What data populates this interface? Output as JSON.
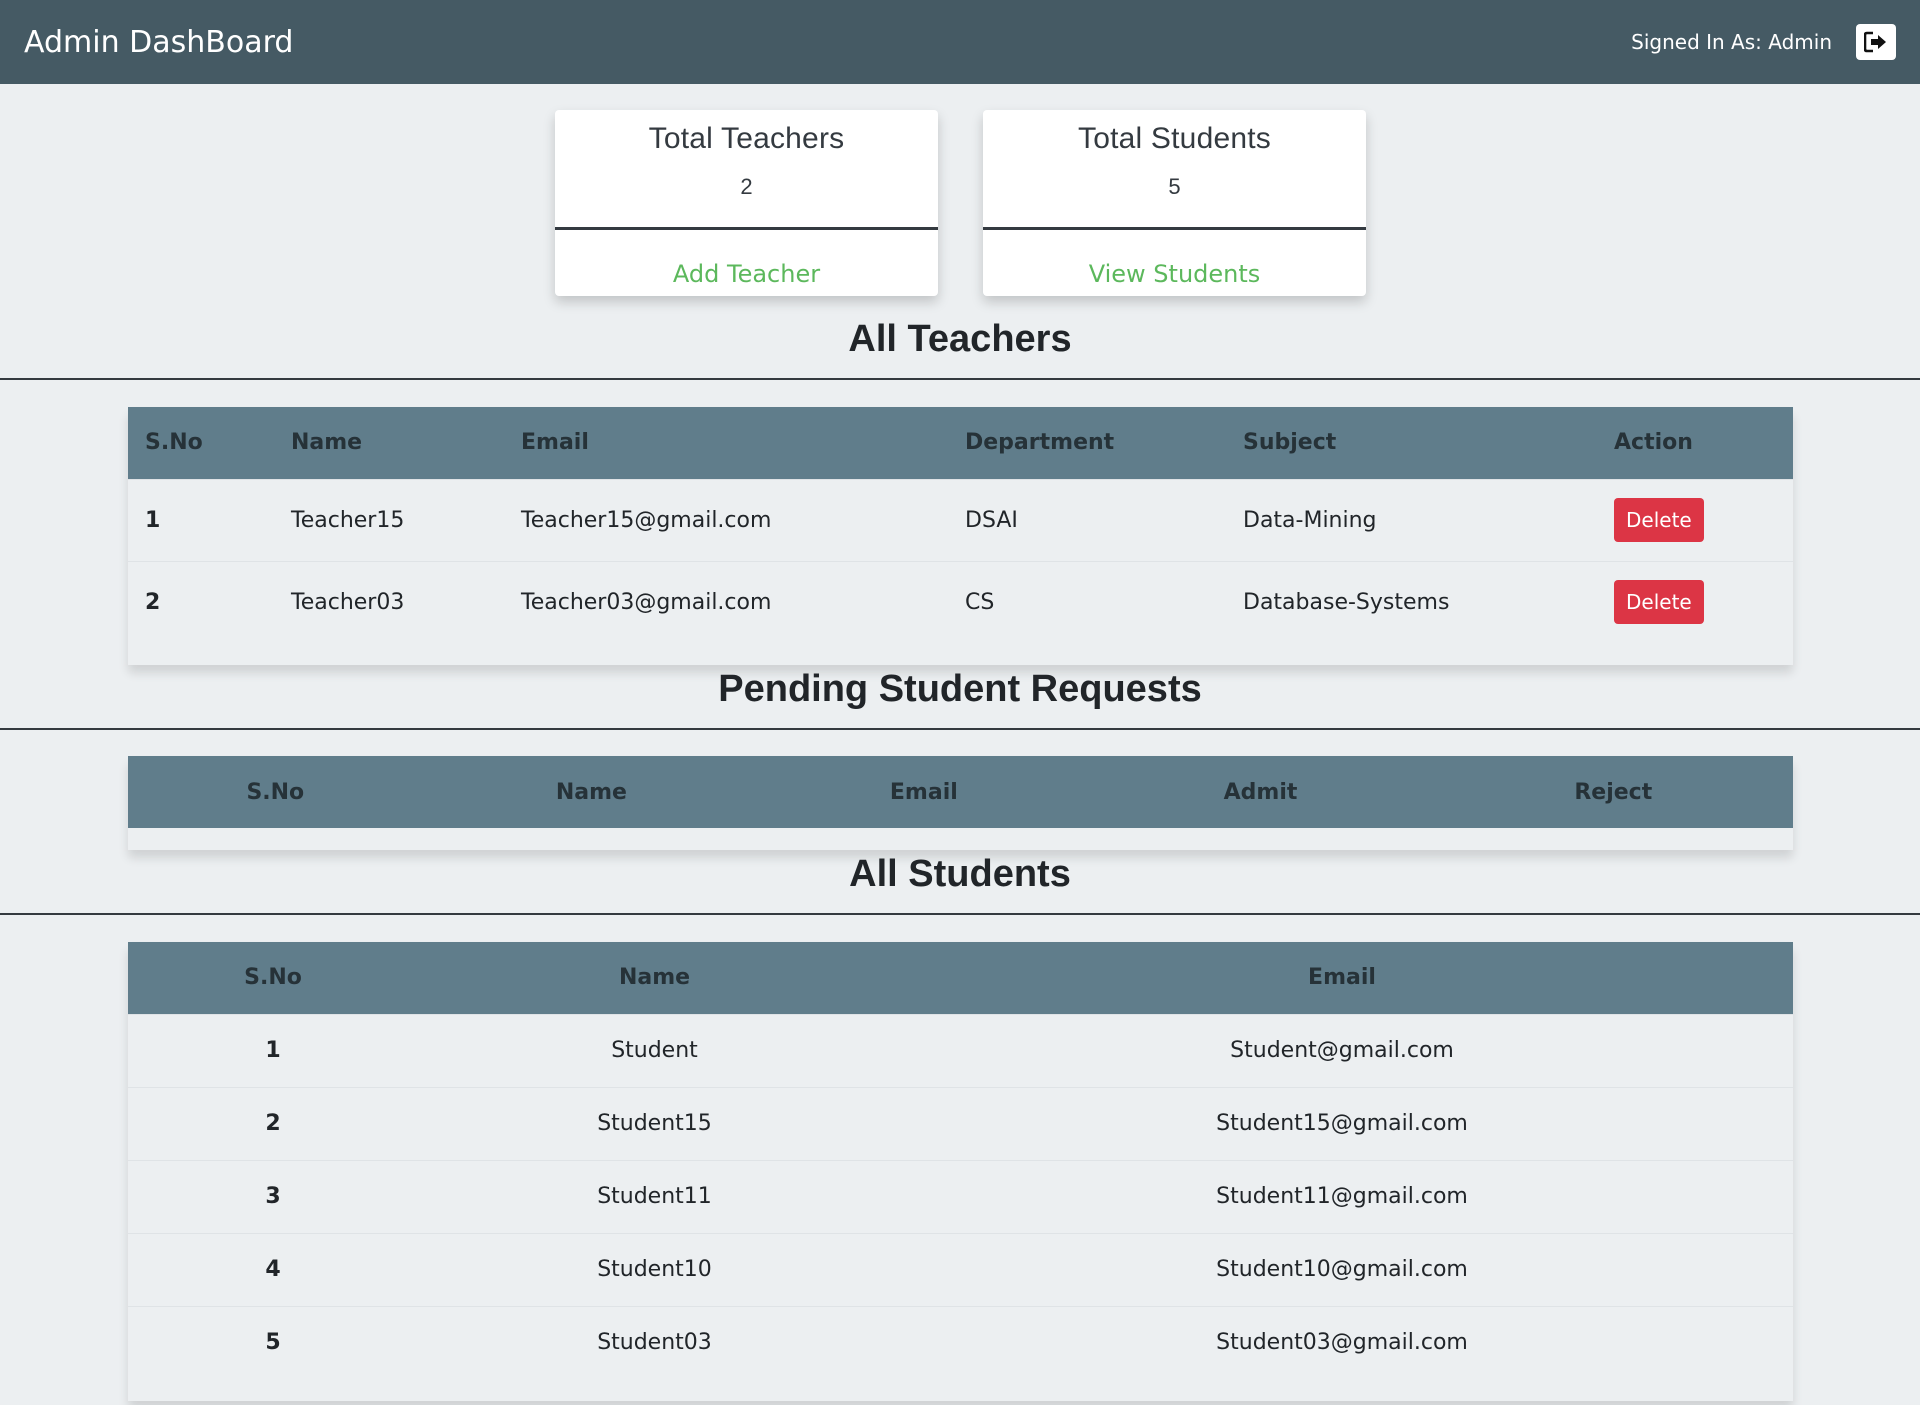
{
  "header": {
    "title": "Admin DashBoard",
    "signed_in": "Signed In As: Admin",
    "logout_icon": "sign-out-icon"
  },
  "cards": [
    {
      "title": "Total Teachers",
      "count": "2",
      "link": "Add Teacher"
    },
    {
      "title": "Total Students",
      "count": "5",
      "link": "View Students"
    }
  ],
  "teachers_section": {
    "title": "All Teachers",
    "columns": [
      "S.No",
      "Name",
      "Email",
      "Department",
      "Subject",
      "Action"
    ],
    "rows": [
      {
        "sno": "1",
        "name": "Teacher15",
        "email": "Teacher15@gmail.com",
        "department": "DSAI",
        "subject": "Data-Mining",
        "action": "Delete"
      },
      {
        "sno": "2",
        "name": "Teacher03",
        "email": "Teacher03@gmail.com",
        "department": "CS",
        "subject": "Database-Systems",
        "action": "Delete"
      }
    ]
  },
  "pending_section": {
    "title": "Pending Student Requests",
    "columns": [
      "S.No",
      "Name",
      "Email",
      "Admit",
      "Reject"
    ]
  },
  "students_section": {
    "title": "All Students",
    "columns": [
      "S.No",
      "Name",
      "Email"
    ],
    "rows": [
      {
        "sno": "1",
        "name": "Student",
        "email": "Student@gmail.com"
      },
      {
        "sno": "2",
        "name": "Student15",
        "email": "Student15@gmail.com"
      },
      {
        "sno": "3",
        "name": "Student11",
        "email": "Student11@gmail.com"
      },
      {
        "sno": "4",
        "name": "Student10",
        "email": "Student10@gmail.com"
      },
      {
        "sno": "5",
        "name": "Student03",
        "email": "Student03@gmail.com"
      }
    ]
  },
  "colors": {
    "navbar": "#455a64",
    "table_header": "#607d8b",
    "link_green": "#5cb85c",
    "delete_red": "#dc3545"
  }
}
